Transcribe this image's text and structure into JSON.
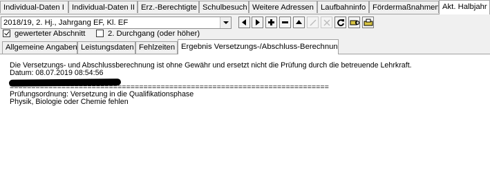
{
  "top_tabs": [
    {
      "label": "Individual-Daten I"
    },
    {
      "label": "Individual-Daten II"
    },
    {
      "label": "Erz.-Berechtigte"
    },
    {
      "label": "Schulbesuch"
    },
    {
      "label": "Weitere Adressen"
    },
    {
      "label": "Laufbahninfo"
    },
    {
      "label": "Fördermaßnahmen"
    },
    {
      "label": "Akt. Halbjahr",
      "active": true
    }
  ],
  "selector": {
    "value": "2018/19, 2. Hj., Jahrgang EF, Kl. EF"
  },
  "toolbar": {
    "icons": [
      "first-record-icon",
      "next-record-icon",
      "add-icon",
      "remove-icon",
      "collapse-icon",
      "edit-icon",
      "cancel-icon",
      "refresh-icon",
      "print-preview-icon",
      "print-icon"
    ]
  },
  "checkboxes": [
    {
      "label": "gewerteter Abschnitt",
      "checked": true
    },
    {
      "label": "2. Durchgang (oder höher)",
      "checked": false
    }
  ],
  "sub_tabs": [
    {
      "label": "Allgemeine Angaben"
    },
    {
      "label": "Leistungsdaten"
    },
    {
      "label": "Fehlzeiten"
    },
    {
      "label": "Ergebnis Versetzungs-/Abschluss-Berechnung",
      "active": true
    }
  ],
  "result": {
    "line1": "Die Versetzungs- und Abschlussberechnung ist ohne Gewähr und ersetzt nicht die Prüfung durch die betreuende Lehrkraft.",
    "line2": "Datum: 08.07.2019 08:54:56",
    "line3": "",
    "separator": "==========================================================================",
    "line5": "Prüfungsordnung: Versetzung in die Qualifikationsphase",
    "line6": "Physik, Biologie oder Chemie fehlen"
  }
}
